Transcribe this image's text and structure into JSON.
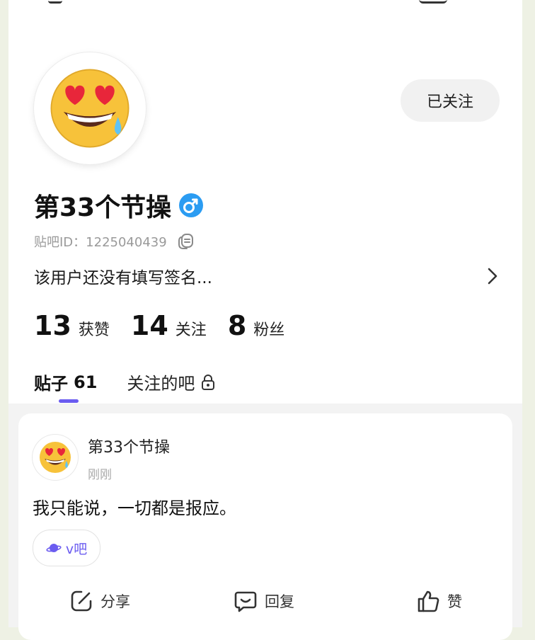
{
  "profile": {
    "follow_button": "已关注",
    "username": "第33个节操",
    "id_text": "贴吧ID：1225040439",
    "bio": "该用户还没有填写签名...",
    "stats": [
      {
        "value": "13",
        "label": "获赞"
      },
      {
        "value": "14",
        "label": "关注"
      },
      {
        "value": "8",
        "label": "粉丝"
      }
    ]
  },
  "tabs": [
    {
      "label": "贴子",
      "count": "61"
    },
    {
      "label": "关注的吧"
    }
  ],
  "post": {
    "author": "第33个节操",
    "time": "刚刚",
    "body": "我只能说，一切都是报应。",
    "bar_name": "v吧",
    "actions": {
      "share": "分享",
      "reply": "回复",
      "like": "赞"
    }
  },
  "colors": {
    "accent": "#6b5cf0",
    "gender": "#2b9cf2"
  },
  "icons": {
    "avatar": "heart-eyes-sweat-emoji",
    "gender": "male-icon",
    "copy": "copy-icon",
    "lock": "lock-icon",
    "share": "share-icon",
    "reply": "comment-icon",
    "like": "thumbs-up-icon"
  }
}
